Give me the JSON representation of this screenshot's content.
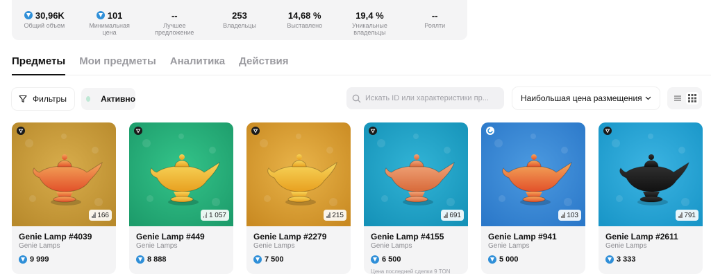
{
  "stats": [
    {
      "value": "30,96K",
      "label": "Общий объем",
      "ton": true
    },
    {
      "value": "101",
      "label": "Минимальная цена",
      "ton": true
    },
    {
      "value": "--",
      "label": "Лучшее предложение",
      "ton": false
    },
    {
      "value": "253",
      "label": "Владельцы",
      "ton": false
    },
    {
      "value": "14,68 %",
      "label": "Выставлено",
      "ton": false
    },
    {
      "value": "19,4 %",
      "label": "Уникальные владельцы",
      "ton": false
    },
    {
      "value": "--",
      "label": "Роялти",
      "ton": false
    }
  ],
  "tabs": [
    "Предметы",
    "Мои предметы",
    "Аналитика",
    "Действия"
  ],
  "toolbar": {
    "filters_label": "Фильтры",
    "active_label": "Активно",
    "search_placeholder": "Искать ID или характеристики пр...",
    "sort_label": "Наибольшая цена размещения"
  },
  "cards": [
    {
      "name": "Genie Lamp #4039",
      "collection": "Genie Lamps",
      "price": "9 999",
      "rank": "166",
      "bg": "#b88a2c",
      "bg2": "#d8ad4c",
      "lamp": "#e2512a",
      "lamp2": "#f3a65a",
      "last": "",
      "corner": "dark"
    },
    {
      "name": "Genie Lamp #449",
      "collection": "Genie Lamps",
      "price": "8 888",
      "rank": "1 057",
      "bg": "#1d9c6b",
      "bg2": "#34c48a",
      "lamp": "#e8a020",
      "lamp2": "#f7d55a",
      "last": "",
      "corner": "dark"
    },
    {
      "name": "Genie Lamp #2279",
      "collection": "Genie Lamps",
      "price": "7 500",
      "rank": "215",
      "bg": "#c98a22",
      "bg2": "#e9b44a",
      "lamp": "#e8a020",
      "lamp2": "#f7d55a",
      "last": "",
      "corner": "dark"
    },
    {
      "name": "Genie Lamp #4155",
      "collection": "Genie Lamps",
      "price": "6 500",
      "rank": "691",
      "bg": "#1592b8",
      "bg2": "#32b4d6",
      "lamp": "#d86a3a",
      "lamp2": "#f0a57a",
      "last": "Цена последней сделки 9 TON",
      "corner": "dark"
    },
    {
      "name": "Genie Lamp #941",
      "collection": "Genie Lamps",
      "price": "5 000",
      "rank": "103",
      "bg": "#2b78c9",
      "bg2": "#4c9ae0",
      "lamp": "#e2512a",
      "lamp2": "#f3a65a",
      "last": "",
      "corner": "blue"
    },
    {
      "name": "Genie Lamp #2611",
      "collection": "Genie Lamps",
      "price": "3 333",
      "rank": "791",
      "bg": "#1996c8",
      "bg2": "#3cb4e2",
      "lamp": "#111111",
      "lamp2": "#333333",
      "last": "",
      "corner": "dark"
    }
  ],
  "colors": {
    "ton_blue": "#2f8fd8",
    "active_dot": "#bfe8d5"
  }
}
